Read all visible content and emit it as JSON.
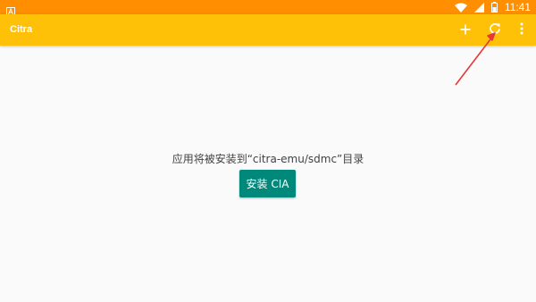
{
  "colors": {
    "status_bar": "#ff8f00",
    "app_bar": "#ffc107",
    "background": "#fafafa",
    "button": "#00897b",
    "arrow": "#e53935"
  },
  "status_bar": {
    "left_icon": "notification-a-icon",
    "icons": [
      "wifi-icon",
      "cellular-signal-icon",
      "battery-icon"
    ],
    "time": "11:41"
  },
  "app_bar": {
    "title": "Citra",
    "actions": [
      "add-icon",
      "refresh-icon",
      "more-vert-icon"
    ]
  },
  "main": {
    "message": "应用将被安装到“citra-emu/sdmc”目录",
    "install_button": "安装 CIA"
  }
}
